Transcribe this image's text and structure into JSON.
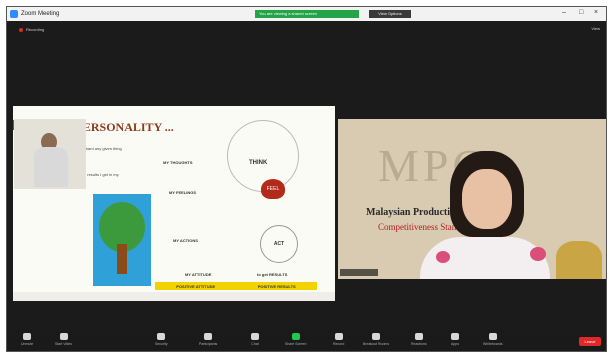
{
  "window": {
    "title": "Zoom Meeting",
    "controls": [
      "–",
      "□",
      "×"
    ]
  },
  "top_bar": {
    "share_status": "You are viewing a shared screen",
    "view_options": "View Options",
    "recording": "Recording",
    "view": "View"
  },
  "slide": {
    "title": "MY PERSONALITY ...",
    "quote1": "The way I think, I feel, I act toward any given thing or person is my attitude.",
    "quote2": "My attitude determines the results I get in my life.",
    "labels": {
      "thoughts": "MY THOUGHTS",
      "feelings": "MY FEELINGS",
      "actions": "MY ACTIONS",
      "attitude": "MY ATTITUDE",
      "get_results": "to get RESULTS",
      "think": "THINK",
      "feel": "FEEL",
      "act": "ACT",
      "positive_attitude": "POSITIVE ATTITUDE",
      "positive_results": "POSITIVE RESULTS"
    }
  },
  "speaker": {
    "backdrop_logo": "MPC",
    "backdrop_org": "Malaysian Productivity Council",
    "backdrop_tagline": "Competitiveness Standards"
  },
  "toolbar": {
    "items": [
      {
        "label": "Unmute",
        "icon": "microphone-icon"
      },
      {
        "label": "Start Video",
        "icon": "video-camera-icon"
      },
      {
        "label": "Security",
        "icon": "shield-icon"
      },
      {
        "label": "Participants",
        "icon": "participants-icon"
      },
      {
        "label": "Chat",
        "icon": "chat-icon"
      },
      {
        "label": "Share Screen",
        "icon": "share-screen-icon"
      },
      {
        "label": "Record",
        "icon": "record-icon"
      },
      {
        "label": "Breakout Rooms",
        "icon": "breakout-rooms-icon"
      },
      {
        "label": "Reactions",
        "icon": "reactions-icon"
      },
      {
        "label": "Apps",
        "icon": "apps-icon"
      },
      {
        "label": "Whiteboards",
        "icon": "whiteboard-icon"
      }
    ],
    "end": "Leave"
  }
}
